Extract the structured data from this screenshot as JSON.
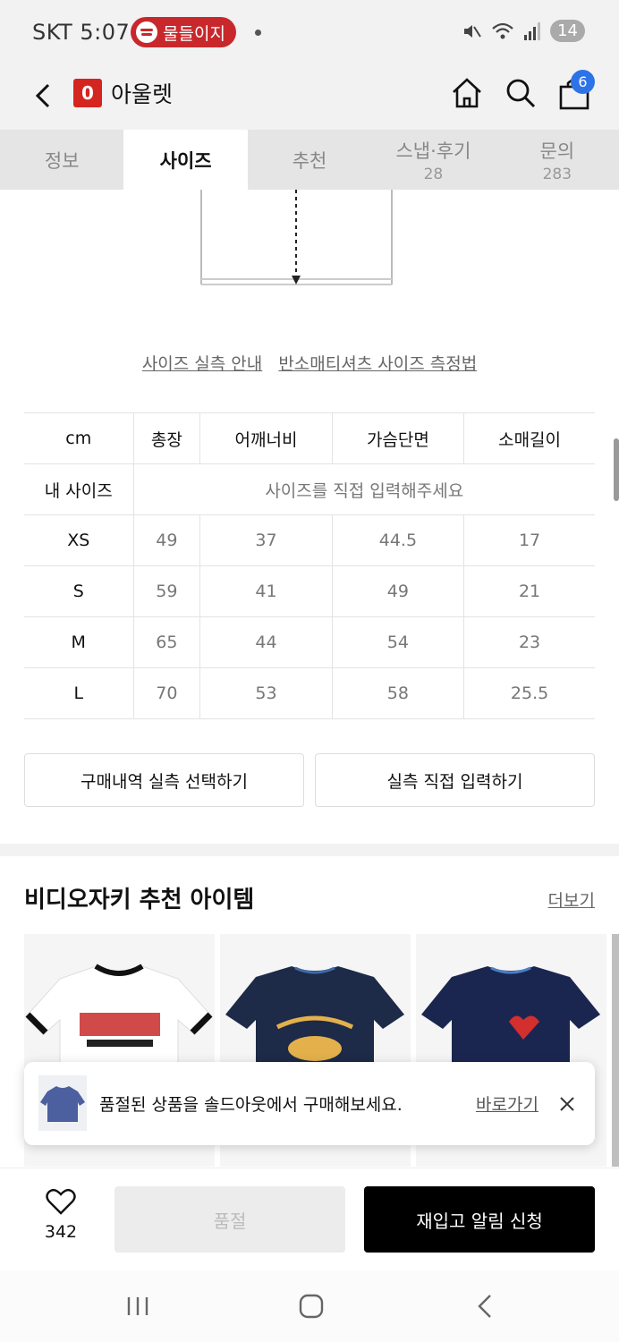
{
  "status_bar": {
    "carrier_time": "SKT 5:07",
    "now_playing": "물들이지",
    "battery": "14"
  },
  "header": {
    "logo_letter": "0",
    "title": "아울렛",
    "cart_count": "6",
    "icons": [
      "back-icon",
      "home-icon",
      "search-icon",
      "shopping-bag-icon"
    ]
  },
  "tabs": [
    {
      "label": "정보",
      "count": ""
    },
    {
      "label": "사이즈",
      "count": ""
    },
    {
      "label": "추천",
      "count": ""
    },
    {
      "label": "스냅·후기",
      "count": "28"
    },
    {
      "label": "문의",
      "count": "283"
    }
  ],
  "size_links": {
    "guide": "사이즈 실측 안내",
    "method": "반소매티셔츠 사이즈 측정법"
  },
  "size_table": {
    "headers": [
      "cm",
      "총장",
      "어깨너비",
      "가슴단면",
      "소매길이"
    ],
    "my_size_label": "내 사이즈",
    "my_size_prompt": "사이즈를 직접 입력해주세요",
    "rows": [
      {
        "size": "XS",
        "values": [
          "49",
          "37",
          "44.5",
          "17"
        ]
      },
      {
        "size": "S",
        "values": [
          "59",
          "41",
          "49",
          "21"
        ]
      },
      {
        "size": "M",
        "values": [
          "65",
          "44",
          "54",
          "23"
        ]
      },
      {
        "size": "L",
        "values": [
          "70",
          "53",
          "58",
          "25.5"
        ]
      }
    ]
  },
  "buttons": {
    "purchase_history": "구매내역 실측 선택하기",
    "manual_input": "실측 직접 입력하기"
  },
  "recommend": {
    "title": "비디오자키 추천 아이템",
    "more": "더보기"
  },
  "toast": {
    "message": "품절된 상품을 솔드아웃에서 구매해보세요.",
    "link": "바로가기"
  },
  "bottom_bar": {
    "like_count": "342",
    "soldout_label": "품절",
    "restock_label": "재입고 알림 신청"
  }
}
